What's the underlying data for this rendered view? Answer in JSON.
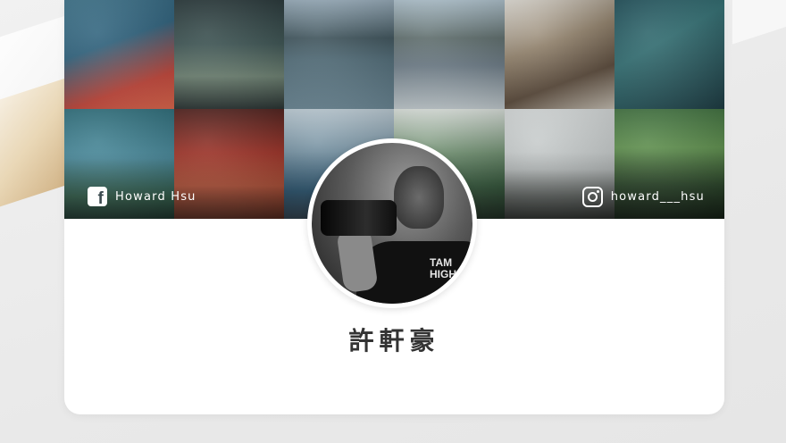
{
  "profile": {
    "name": "許軒豪",
    "facebook_name": "Howard Hsu",
    "instagram_handle": "howard___hsu",
    "avatar_shirt_text": "TAM\nHIGH"
  },
  "icons": {
    "facebook": "facebook-icon",
    "instagram": "instagram-icon"
  },
  "colors": {
    "card_background": "#ffffff",
    "page_background": "#ececec",
    "name_text": "#333333",
    "overlay_text": "#ffffff"
  }
}
